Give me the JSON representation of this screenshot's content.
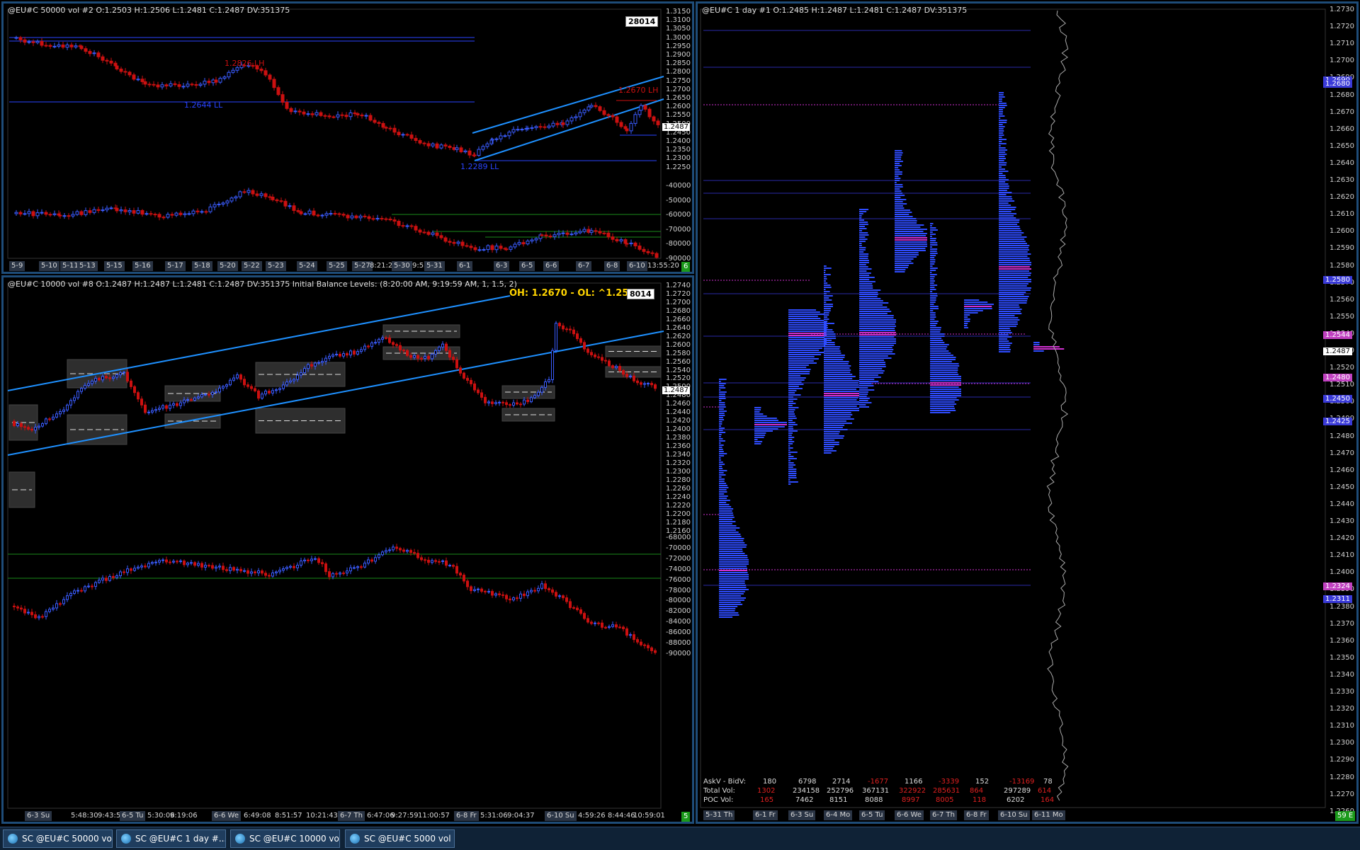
{
  "windows": {
    "top_left": {
      "title": "@EU#C  50000 vol  #2 O:1.2503 H:1.2506 L:1.2481 C:1.2487 DV:351375",
      "badge": "28014",
      "price_labels": [
        "1.3150",
        "1.3100",
        "1.3050",
        "1.3000",
        "1.2950",
        "1.2900",
        "1.2850",
        "1.2800",
        "1.2750",
        "1.2700",
        "1.2650",
        "1.2600",
        "1.2550",
        "1.2500",
        "1.2450",
        "1.2400",
        "1.2350",
        "1.2300",
        "1.2250"
      ],
      "current_price": "1.2487",
      "delta_labels": [
        "-40000",
        "-50000",
        "-60000",
        "-70000",
        "-80000",
        "-90000"
      ],
      "annotations": {
        "lh1": "1.2826 LH",
        "ll1": "1.2644 LL",
        "ll2": "1.2289 LL",
        "lh2": "1.2670 LH"
      },
      "x_labels": [
        "5-9",
        "5-10",
        "5-11",
        "5-13",
        "5-15",
        "5-16",
        "5-17",
        "5-18",
        "5-20",
        "5-22",
        "5-23",
        "5-24",
        "5-25",
        "5-27",
        "8:21:27",
        "5-30",
        "9:53",
        "5-31",
        "6-1",
        "6-3",
        "6-5",
        "6-6",
        "6-7",
        "6-8",
        "6-10",
        "13:55:20"
      ],
      "corner": "6"
    },
    "bottom_left": {
      "title": "@EU#C  10000 vol  #8 O:1.2487 H:1.2487 L:1.2481 C:1.2487 DV:351375  Initial Balance Levels:   (8:20:00 AM, 9:19:59 AM, 1, 1.5, 2)",
      "oh_ol": "OH: 1.2670 - OL: ^1.2546",
      "badge": "8014",
      "price_labels": [
        "1.2740",
        "1.2720",
        "1.2700",
        "1.2680",
        "1.2660",
        "1.2640",
        "1.2620",
        "1.2600",
        "1.2580",
        "1.2560",
        "1.2540",
        "1.2520",
        "1.2500",
        "1.2480",
        "1.2460",
        "1.2440",
        "1.2420",
        "1.2400",
        "1.2380",
        "1.2360",
        "1.2340",
        "1.2320",
        "1.2300",
        "1.2280",
        "1.2260",
        "1.2240",
        "1.2220",
        "1.2200",
        "1.2180",
        "1.2160"
      ],
      "current_price": "1.2487",
      "delta_labels": [
        "-68000",
        "-70000",
        "-72000",
        "-74000",
        "-76000",
        "-78000",
        "-80000",
        "-82000",
        "-84000",
        "-86000",
        "-88000",
        "-90000"
      ],
      "x_labels": [
        "6-3 Su",
        "5:48:30",
        "9:43:52",
        "6-5 Tu",
        "5:30:06",
        "9:19:06",
        "6-6 We",
        "6:49:08",
        "8:51:57",
        "10:21:43",
        "6-7 Th",
        "6:47:06",
        "9:27:59",
        "11:00:57",
        "6-8 Fr",
        "5:31:06",
        "9:04:37",
        "6-10 Su",
        "4:59:26",
        "8:44:46",
        "10:59:01"
      ],
      "corner": "5"
    },
    "right": {
      "title": "@EU#C  1 day  #1 O:1.2485 H:1.2487 L:1.2481 C:1.2487 DV:351375",
      "price_labels": [
        "1.2730",
        "1.2720",
        "1.2710",
        "1.2700",
        "1.2690",
        "1.2680",
        "1.2670",
        "1.2660",
        "1.2650",
        "1.2640",
        "1.2630",
        "1.2620",
        "1.2610",
        "1.2600",
        "1.2590",
        "1.2580",
        "1.2570",
        "1.2560",
        "1.2550",
        "1.2540",
        "1.2530",
        "1.2520",
        "1.2510",
        "1.2500",
        "1.2490",
        "1.2480",
        "1.2470",
        "1.2460",
        "1.2450",
        "1.2440",
        "1.2430",
        "1.2420",
        "1.2410",
        "1.2400",
        "1.2390",
        "1.2380",
        "1.2370",
        "1.2360",
        "1.2350",
        "1.2340",
        "1.2330",
        "1.2320",
        "1.2310",
        "1.2300",
        "1.2290",
        "1.2280",
        "1.2270",
        "1.2260"
      ],
      "highlighted_prices": [
        {
          "text": "1.2690",
          "color": "#3a3ad8"
        },
        {
          "text": "1.2680",
          "color": "#3a3ad8"
        },
        {
          "text": "1.2580",
          "color": "#3a3ad8"
        },
        {
          "text": "1.2544",
          "color": "#c040c0"
        },
        {
          "text": "1.2487",
          "color": "#ffffff"
        },
        {
          "text": "1.2480",
          "color": "#c040c0"
        },
        {
          "text": "1.2450",
          "color": "#3a3ad8"
        },
        {
          "text": "1.2425",
          "color": "#3a3ad8"
        },
        {
          "text": "1.2324",
          "color": "#c040c0"
        },
        {
          "text": "1.2311",
          "color": "#3a3ad8"
        }
      ],
      "stats": {
        "row_labels": [
          "AskV - BidV:",
          "Total Vol:",
          "POC Vol:"
        ],
        "columns": [
          {
            "askbid": "180",
            "total": "1302",
            "poc": "165"
          },
          {
            "askbid": "6798",
            "total": "234158",
            "poc": "7462"
          },
          {
            "askbid": "2714",
            "total": "252796",
            "poc": "8151"
          },
          {
            "askbid": "-1677",
            "total": "367131",
            "poc": "8088"
          },
          {
            "askbid": "1166",
            "total": "322922",
            "poc": "8997"
          },
          {
            "askbid": "-3339",
            "total": "285631",
            "poc": "8005"
          },
          {
            "askbid": "152",
            "total": "864",
            "poc": "118"
          },
          {
            "askbid": "-13169",
            "total": "297289",
            "poc": "6202"
          },
          {
            "askbid": "78",
            "total": "614",
            "poc": "164"
          }
        ]
      },
      "x_labels": [
        "5-31 Th",
        "6-1 Fr",
        "6-3 Su",
        "6-4 Mo",
        "6-5 Tu",
        "6-6 We",
        "6-7 Th",
        "6-8 Fr",
        "6-10 Su",
        "6-11 Mo"
      ],
      "corner": "59 E"
    }
  },
  "taskbar": [
    {
      "label": "SC @EU#C  50000 vo..."
    },
    {
      "label": "SC @EU#C  1 day   #..."
    },
    {
      "label": "SC @EU#C  10000 vo..."
    },
    {
      "label": "SC @EU#C  5000 vol ..."
    }
  ],
  "colors": {
    "up": "#3a5cff",
    "down": "#cc1010",
    "channel": "#1e90ff",
    "poc": "#c020c0",
    "frame": "#1e4c78"
  }
}
